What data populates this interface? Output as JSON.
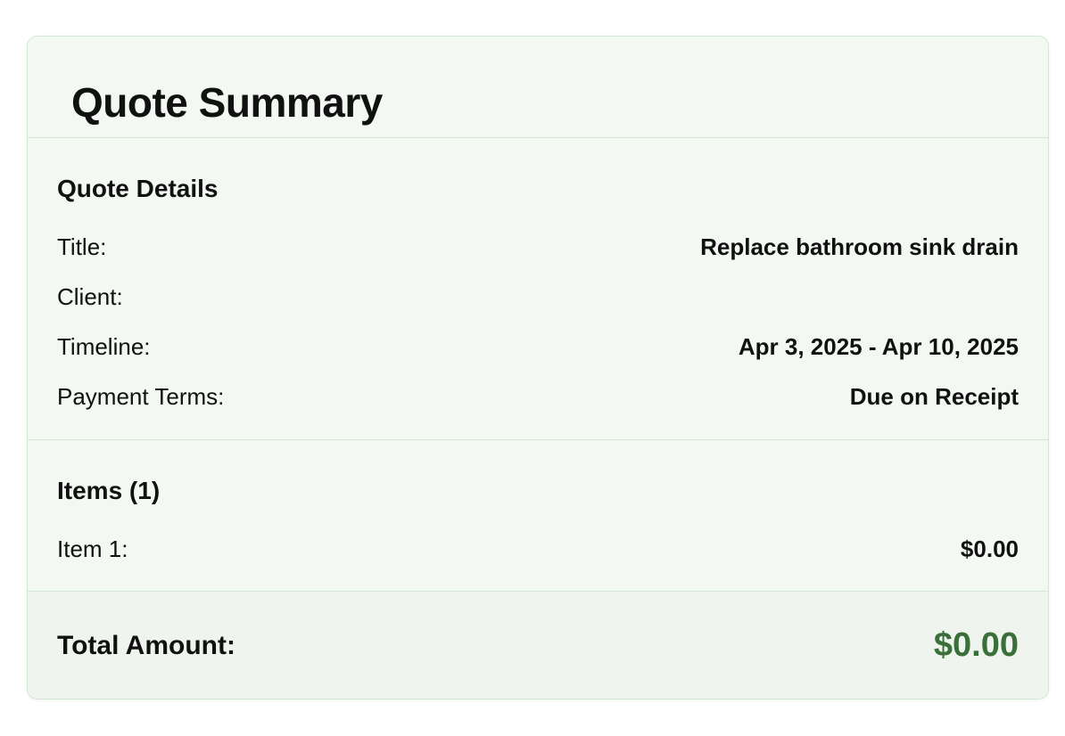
{
  "header": {
    "title": "Quote Summary"
  },
  "details": {
    "heading": "Quote Details",
    "rows": [
      {
        "label": "Title:",
        "value": "Replace bathroom sink drain"
      },
      {
        "label": "Client:",
        "value": ""
      },
      {
        "label": "Timeline:",
        "value": "Apr 3, 2025 - Apr 10, 2025"
      },
      {
        "label": "Payment Terms:",
        "value": "Due on Receipt"
      }
    ]
  },
  "items": {
    "heading": "Items (1)",
    "rows": [
      {
        "label": "Item 1:",
        "value": "$0.00"
      }
    ]
  },
  "total": {
    "label": "Total Amount:",
    "value": "$0.00",
    "color": "#3a6f3a"
  },
  "colors": {
    "card_background": "#f4f8f3",
    "border": "#d3e8d2",
    "total_background": "#eff5ee"
  }
}
